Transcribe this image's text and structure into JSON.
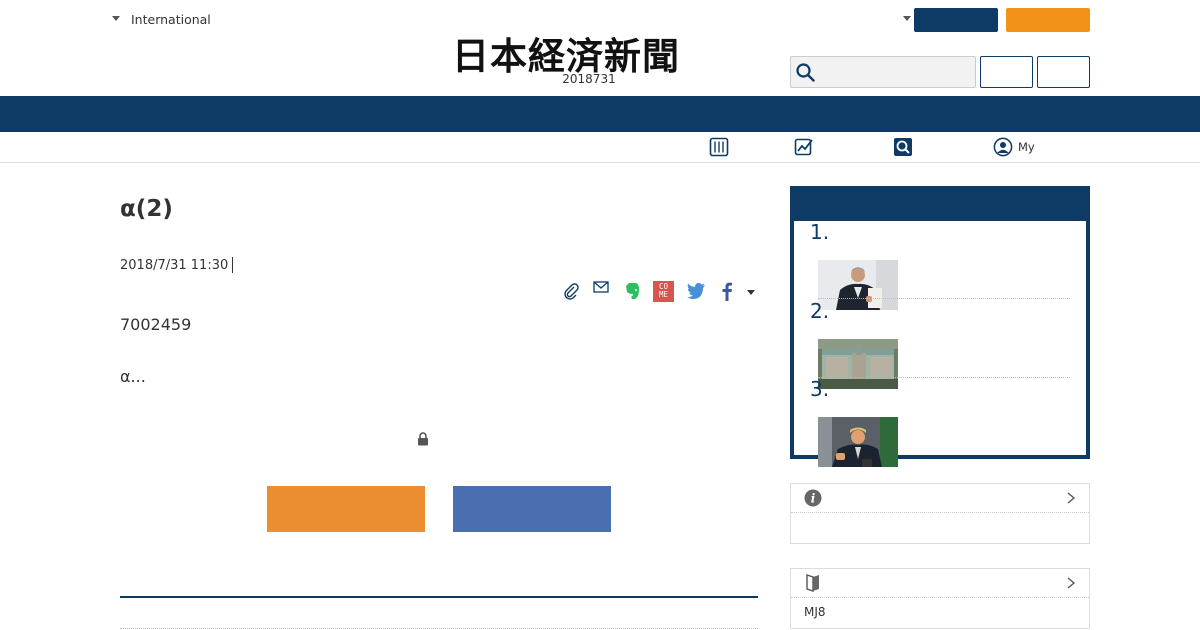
{
  "header": {
    "edition_label": "International",
    "logo_text": "日本経済新聞",
    "date": "2018731",
    "my_label": "My",
    "colors": {
      "navy": "#0d3b66",
      "orange": "#f39219"
    },
    "search_placeholder": ""
  },
  "article": {
    "title": "α(2)",
    "timestamp": "2018/7/31 11:30",
    "body_lines": [
      "7002459",
      "α..."
    ],
    "share_icons": [
      "clip-icon",
      "mail-icon",
      "evernote-icon",
      "come-icon",
      "twitter-icon",
      "facebook-icon"
    ],
    "come_icon_text": "CO ME",
    "cta_colors": {
      "primary": "#ea8e31",
      "secondary": "#4a6fb0"
    }
  },
  "ranking": {
    "items": [
      {
        "rank": "1.",
        "thumb": "man-with-document-photo"
      },
      {
        "rank": "2.",
        "thumb": "building-aerial-photo"
      },
      {
        "rank": "3.",
        "thumb": "trump-speech-photo"
      }
    ]
  },
  "sidebar": {
    "info_icon": "info-icon",
    "mj_label": "MJ8",
    "mj_icon": "book-icon"
  }
}
